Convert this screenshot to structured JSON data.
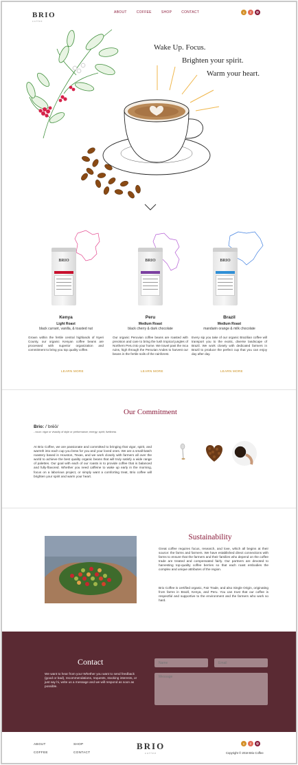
{
  "brand": {
    "name": "BRIO",
    "tagline": "coffee"
  },
  "nav": [
    "ABOUT",
    "COFFEE",
    "SHOP",
    "CONTACT"
  ],
  "social": [
    {
      "icon": "twitter-icon",
      "glyph": "t",
      "color": "#d4902a"
    },
    {
      "icon": "facebook-icon",
      "glyph": "f",
      "color": "#e26a55"
    },
    {
      "icon": "instagram-icon",
      "glyph": "◎",
      "color": "#8a1b3a"
    }
  ],
  "hero": {
    "line1": "Wake Up. Focus.",
    "line2": "Brighten your spirit.",
    "line3": "Warm your heart."
  },
  "products": [
    {
      "name": "Kenya",
      "bag_origin": "KENYA",
      "band_color": "#c8102e",
      "map_color": "#e4488f",
      "roast": "Light Roast",
      "notes": "black currant, vanilla, & toasted nut",
      "description": "Grown within the fertile central highlands of Nyeri County, our organic Kenyan coffee beans are processed with superior organization and commitment to bring you top quality coffee.",
      "cta": "LEARN MORE"
    },
    {
      "name": "Peru",
      "bag_origin": "PERU",
      "band_color": "#7b3fa0",
      "map_color": "#b35ad4",
      "roast": "Medium Roast",
      "notes": "black cherry & dark chocolate",
      "description": "Our organic Peruvian coffee beans are roasted with precision and care to bring the lush tropical jungles of Northern Peru into your home. We travel past the Inca ruins, high through the Peruvian Andes to harvest our beans in the fertile soils of the rainforest.",
      "cta": "LEARN MORE"
    },
    {
      "name": "Brazil",
      "bag_origin": "BRAZIL",
      "band_color": "#2f8fd6",
      "map_color": "#3f7fe0",
      "roast": "Medium Roast",
      "notes": "mandarin orange & milk chocolate",
      "description": "Every sip you take of our organic Brazilian coffee will transport you to the exotic, diverse landscape of Brazil. We work closely with dedicated farmers in Brazil to produce the perfect cup that you can enjoy day after day.",
      "cta": "LEARN MORE"
    }
  ],
  "commitment": {
    "title": "Our Commitment",
    "word": "Brio:",
    "pronunciation": "/ˈbrēō/",
    "meaning": "- noun: vigor or vivacity of style or performance; energy; spirit; liveliness",
    "body": "At Brio Coffee, we are passionate and committed to bringing that vigor, spirit, and warmth into each cup you brew for you and your loved ones. We are a small-batch roastery based in Houston, Texas, and we work closely with farmers all over the world to achieve the best quality organic beans that will truly satisfy a wide range of palettes. Our goal with each of our roasts is to provide coffee that is balanced and fully-flavored. Whether you need caffeine to wake up early in the morning, focus on a laborious project, or simply want a comforting treat, Brio coffee will brighten your spirit and warm your heart."
  },
  "sustainability": {
    "title": "Sustainability",
    "p1": "Great coffee requires focus, research, and love, which all begins at their source: the farms and farmers. We have established direct connections with farms to ensure that the farmers and their families who depend on the coffee trade are treated and compensated fairly. Our partners are devoted to harvesting top-quality coffee berries so that each roast embodies the complex and unique attributes of the region.",
    "p2": "Brio Coffee is certified organic, Fair Trade, and also Single Origin, originating from farms in Brazil, Kenya, and Peru. You can trust that our coffee is respectful and supportive to the environment and the farmers who work so hard."
  },
  "contact": {
    "title": "Contact",
    "body": "We want to hear from you! Whether you want to send feedback (good or bad), recommendations, requests, stocking interests, or just say hi, write us a message and we will respond as soon as possible.",
    "name_placeholder": "Name",
    "email_placeholder": "Email",
    "message_placeholder": "Message"
  },
  "footer": {
    "links": [
      "ABOUT",
      "SHOP",
      "COFFEE",
      "CONTACT"
    ],
    "copyright": "Copyright © 2018 Brio Coffee"
  }
}
